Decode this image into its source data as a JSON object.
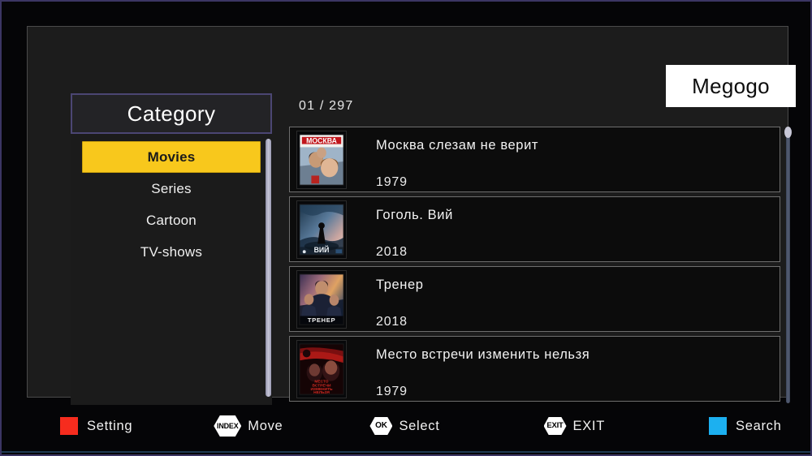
{
  "app": {
    "brand": "Megogo"
  },
  "sidebar": {
    "header": "Category",
    "items": [
      {
        "label": "Movies",
        "selected": true
      },
      {
        "label": "Series",
        "selected": false
      },
      {
        "label": "Cartoon",
        "selected": false
      },
      {
        "label": "TV-shows",
        "selected": false
      }
    ]
  },
  "content": {
    "counter": "01 / 297",
    "rows": [
      {
        "title": "Москва слезам не верит",
        "year": "1979",
        "poster": "moskva-slezam-ne-verit-poster",
        "selected": true
      },
      {
        "title": "Гоголь. Вий",
        "year": "2018",
        "poster": "gogol-viy-poster",
        "selected": false
      },
      {
        "title": "Тренер",
        "year": "2018",
        "poster": "trener-poster",
        "selected": false
      },
      {
        "title": "Место встречи изменить нельзя",
        "year": "1979",
        "poster": "mesto-vstrechi-izmenit-nelzya-poster",
        "selected": false
      }
    ]
  },
  "toolbar": {
    "items": [
      {
        "key": "",
        "icon": "red-square-key-icon",
        "label": "Setting",
        "color": "#f62c1e"
      },
      {
        "key": "INDEX",
        "icon": "index-hex-key-icon",
        "label": "Move",
        "color": "#ffffff"
      },
      {
        "key": "OK",
        "icon": "ok-hex-key-icon",
        "label": "Select",
        "color": "#ffffff"
      },
      {
        "key": "EXIT",
        "icon": "exit-hex-key-icon",
        "label": "EXIT",
        "color": "#ffffff"
      },
      {
        "key": "",
        "icon": "blue-square-key-icon",
        "label": "Search",
        "color": "#1cb0f0"
      }
    ]
  },
  "theme": {
    "accent_selected": "#f8c81c",
    "frame_border": "#3b3663",
    "panel_bg": "#1c1c1c",
    "row_border": "#6e6e6e"
  }
}
